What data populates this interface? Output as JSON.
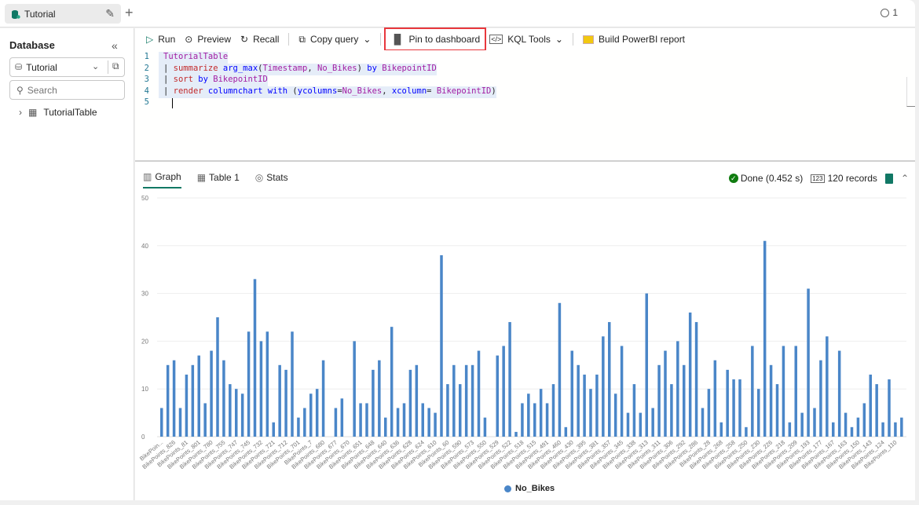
{
  "topbar": {
    "tab_title": "Tutorial",
    "add_tab": "+",
    "copies_count": "1"
  },
  "sidebar": {
    "title": "Database",
    "database_selected": "Tutorial",
    "search_placeholder": "Search",
    "tree": [
      {
        "label": "TutorialTable"
      }
    ]
  },
  "toolbar": {
    "run": "Run",
    "preview": "Preview",
    "recall": "Recall",
    "copy_query": "Copy query",
    "pin": "Pin to dashboard",
    "kql_tools": "KQL Tools",
    "powerbi": "Build PowerBI report"
  },
  "editor": {
    "lines": [
      {
        "n": "1",
        "tokens": [
          {
            "t": "TutorialTable",
            "c": "id"
          }
        ]
      },
      {
        "n": "2",
        "tokens": [
          {
            "t": "| ",
            "c": "tx"
          },
          {
            "t": "summarize",
            "c": "kw"
          },
          {
            "t": " ",
            "c": "tx"
          },
          {
            "t": "arg_max",
            "c": "fn"
          },
          {
            "t": "(",
            "c": "tx"
          },
          {
            "t": "Timestamp",
            "c": "id"
          },
          {
            "t": ", ",
            "c": "tx"
          },
          {
            "t": "No_Bikes",
            "c": "id"
          },
          {
            "t": ") ",
            "c": "tx"
          },
          {
            "t": "by",
            "c": "fn"
          },
          {
            "t": " ",
            "c": "tx"
          },
          {
            "t": "BikepointID",
            "c": "id"
          }
        ]
      },
      {
        "n": "3",
        "tokens": [
          {
            "t": "| ",
            "c": "tx"
          },
          {
            "t": "sort",
            "c": "kw"
          },
          {
            "t": " ",
            "c": "tx"
          },
          {
            "t": "by",
            "c": "fn"
          },
          {
            "t": " ",
            "c": "tx"
          },
          {
            "t": "BikepointID",
            "c": "id"
          }
        ]
      },
      {
        "n": "4",
        "tokens": [
          {
            "t": "| ",
            "c": "tx"
          },
          {
            "t": "render",
            "c": "kw"
          },
          {
            "t": " ",
            "c": "tx"
          },
          {
            "t": "columnchart",
            "c": "fn"
          },
          {
            "t": " ",
            "c": "tx"
          },
          {
            "t": "with",
            "c": "fn"
          },
          {
            "t": " (",
            "c": "tx"
          },
          {
            "t": "ycolumns",
            "c": "fn"
          },
          {
            "t": "=",
            "c": "tx"
          },
          {
            "t": "No_Bikes",
            "c": "id"
          },
          {
            "t": ", ",
            "c": "tx"
          },
          {
            "t": "xcolumn",
            "c": "fn"
          },
          {
            "t": "= ",
            "c": "tx"
          },
          {
            "t": "BikepointID",
            "c": "id"
          },
          {
            "t": ")",
            "c": "tx"
          }
        ]
      },
      {
        "n": "5",
        "tokens": []
      }
    ]
  },
  "results": {
    "tabs": [
      {
        "label": "Graph"
      },
      {
        "label": "Table 1"
      },
      {
        "label": "Stats"
      }
    ],
    "status": "Done (0.452 s)",
    "records": "120 records",
    "status_color": "#107c10"
  },
  "chart_data": {
    "type": "bar",
    "title": "",
    "xlabel": "",
    "ylabel": "",
    "ylim": [
      0,
      50
    ],
    "yticks": [
      0,
      10,
      20,
      30,
      40,
      50
    ],
    "grid": true,
    "legend": {
      "position": "bottom",
      "entries": [
        "No_Bikes"
      ]
    },
    "series_color": "#4a86c8",
    "visible_tick_labels": [
      "BikePoin...",
      "BikePoints_826",
      "BikePoints_81",
      "BikePoints_801",
      "BikePoints_780",
      "BikePoints_755",
      "BikePoints_747",
      "BikePoints_745",
      "BikePoints_732",
      "BikePoints_721",
      "BikePoints_712",
      "BikePoints_701",
      "BikePoints_7",
      "BikePoints_680",
      "BikePoints_677",
      "BikePoints_670",
      "BikePoints_651",
      "BikePoints_648",
      "BikePoints_640",
      "BikePoints_636",
      "BikePoints_628",
      "BikePoints_624",
      "BikePoints_610",
      "BikePoints_60",
      "BikePoints_590",
      "BikePoints_573",
      "BikePoints_550",
      "BikePoints_529",
      "BikePoints_522",
      "BikePoints_518",
      "BikePoints_515",
      "BikePoints_491",
      "BikePoints_460",
      "BikePoints_430",
      "BikePoints_395",
      "BikePoints_381",
      "BikePoints_357",
      "BikePoints_345",
      "BikePoints_338",
      "BikePoints_313",
      "BikePoints_311",
      "BikePoints_306",
      "BikePoints_292",
      "BikePoints_286",
      "BikePoints_28",
      "BikePoints_268",
      "BikePoints_258",
      "BikePoints_250",
      "BikePoints_230",
      "BikePoints_226",
      "BikePoints_218",
      "BikePoints_209",
      "BikePoints_193",
      "BikePoints_177",
      "BikePoints_167",
      "BikePoints_163",
      "BikePoints_150",
      "BikePoints_143",
      "BikePoints_124",
      "BikePoints_110"
    ],
    "series": [
      {
        "name": "No_Bikes",
        "values": [
          6,
          15,
          16,
          6,
          13,
          15,
          17,
          7,
          18,
          25,
          16,
          11,
          10,
          9,
          22,
          33,
          20,
          22,
          3,
          15,
          14,
          22,
          4,
          6,
          9,
          10,
          16,
          0,
          6,
          8,
          0,
          20,
          7,
          7,
          14,
          16,
          4,
          23,
          6,
          7,
          14,
          15,
          7,
          6,
          5,
          38,
          11,
          15,
          11,
          15,
          15,
          18,
          4,
          0,
          17,
          19,
          24,
          1,
          7,
          9,
          7,
          10,
          7,
          11,
          28,
          2,
          18,
          15,
          13,
          10,
          13,
          21,
          24,
          9,
          19,
          5,
          11,
          5,
          30,
          6,
          15,
          18,
          11,
          20,
          15,
          26,
          24,
          6,
          10,
          16,
          3,
          14,
          12,
          12,
          2,
          19,
          10,
          41,
          15,
          11,
          19,
          3,
          19,
          5,
          31,
          6,
          16,
          21,
          3,
          18,
          5,
          2,
          4,
          7,
          13,
          11,
          3,
          12,
          3,
          4
        ]
      }
    ]
  }
}
